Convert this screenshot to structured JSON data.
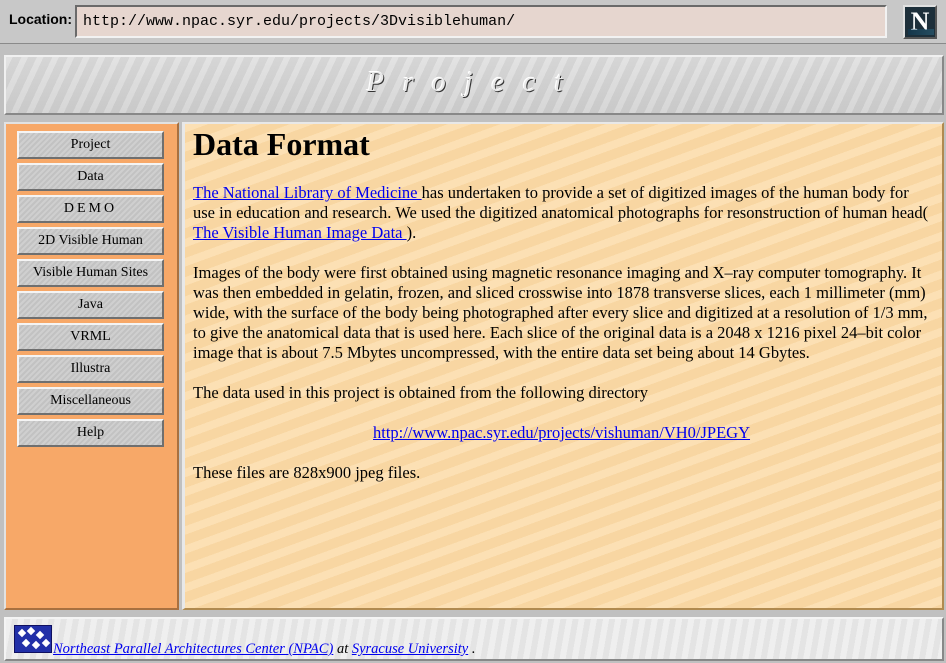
{
  "location_bar": {
    "label": "Location:",
    "url": "http://www.npac.syr.edu/projects/3Dvisiblehuman/",
    "logo_letter": "N"
  },
  "banner": {
    "title": "Project"
  },
  "sidebar": {
    "items": [
      {
        "label": "Project"
      },
      {
        "label": "Data"
      },
      {
        "label": "DEMO"
      },
      {
        "label": "2D Visible Human"
      },
      {
        "label": "Visible Human Sites"
      },
      {
        "label": "Java"
      },
      {
        "label": "VRML"
      },
      {
        "label": "Illustra"
      },
      {
        "label": "Miscellaneous"
      },
      {
        "label": "Help"
      }
    ]
  },
  "main": {
    "heading": "Data Format",
    "p1": {
      "link1": "The National Library of Medicine ",
      "text1": "has undertaken to provide a set of digitized images of the human body for use in education and research. We used the digitized anatomical photographs for resonstruction of human head( ",
      "link2": "The Visible Human Image Data ",
      "text2": ")."
    },
    "p2": "Images of the body were first obtained using magnetic resonance imaging and X–ray computer tomography. It was then embedded in gelatin, frozen, and sliced crosswise into 1878 transverse slices, each 1 millimeter (mm) wide, with the surface of the body being photographed after every slice and digitized at a resolution of 1/3 mm, to give the anatomical data that is used here. Each slice of the original data is a 2048 x 1216 pixel 24–bit color image that is about 7.5 Mbytes uncompressed, with the entire data set being about 14 Gbytes.",
    "p3": "The data used in this project is obtained from the following directory",
    "dir_link": "http://www.npac.syr.edu/projects/vishuman/VH0/JPEGY ",
    "p4": "These files are 828x900 jpeg files."
  },
  "footer": {
    "link1": "Northeast Parallel Architectures Center (NPAC)",
    "mid": " at ",
    "link2": "Syracuse University",
    "end": " ."
  }
}
